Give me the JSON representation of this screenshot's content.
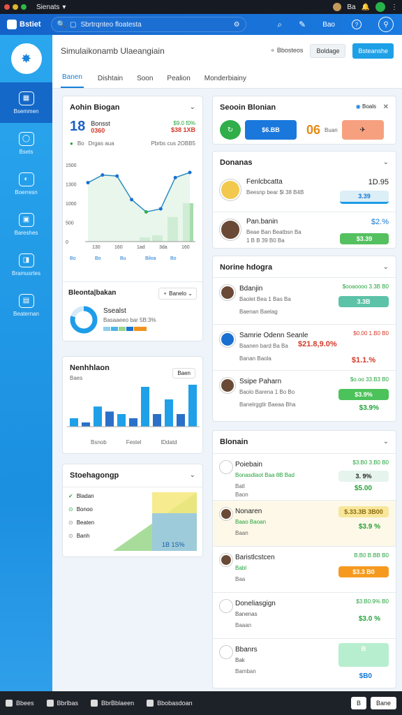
{
  "titlebar": {
    "title": "Sienats",
    "right_text": "Ba"
  },
  "topbar": {
    "logo": "Bstiet",
    "search_placeholder": "Sbrtrqnteo floatesta",
    "btn_label": "Bao"
  },
  "sidebar": {
    "items": [
      {
        "label": "Bsemmen",
        "active": true
      },
      {
        "label": "Bsets"
      },
      {
        "label": "Boerresn"
      },
      {
        "label": "Bareshes"
      },
      {
        "label": "Bramusrtes"
      },
      {
        "label": "Beaternan"
      }
    ]
  },
  "header": {
    "title": "Simulaikonamb Ulaeangiain",
    "link": "Bbosteos",
    "btn_secondary": "Boldage",
    "btn_primary": "Bsteanshe"
  },
  "tabs": [
    "Banen",
    "Dishtain",
    "Soon",
    "Pealion",
    "Monderbiainy"
  ],
  "card_overview": {
    "title": "Aohin Biogan",
    "big_value": "18",
    "sub1": "Bonsst",
    "sub2": "0360",
    "kpi1": "$9.0 f0%",
    "kpi2": "$38 1XB",
    "legend1": "Bo",
    "legend2": "Drgas aua",
    "legend3": "Pbrbs cus 2OBB5",
    "y_ticks": [
      "1500",
      "1300",
      "1000",
      "500",
      "0"
    ],
    "x_ticks": [
      "130",
      "160",
      "1ad",
      "3da",
      "160"
    ],
    "x_labels": [
      "Bo",
      "Bo",
      "Bu",
      "Biloa",
      "Bo"
    ]
  },
  "chart_data": {
    "type": "line",
    "categories": [
      "130",
      "160",
      "1ad",
      "3da",
      "160"
    ],
    "series": [
      {
        "values": [
          1150,
          1300,
          1280,
          820,
          580,
          640,
          1250,
          1350
        ]
      }
    ],
    "bars": [
      80,
      120,
      480,
      750
    ],
    "ylim": [
      0,
      1500
    ]
  },
  "card_donut": {
    "title": "Bleonta|bakan",
    "dropdown": "Banelo",
    "label": "Ssealst",
    "sub": "Basaaeeo bar 5B:3%"
  },
  "card_bars": {
    "title": "Nenhhlaon",
    "btn": "Baen",
    "x_labels": [
      "Bsnob",
      "Festel",
      "lDdatd"
    ],
    "values": [
      20,
      10,
      48,
      36,
      30,
      20,
      95,
      30,
      65,
      30,
      100
    ]
  },
  "card_stack": {
    "title": "Stoehagongp",
    "items": [
      "Bladan",
      "Bonoo",
      "Beaten",
      "Banh"
    ],
    "value": "1B 1S%"
  },
  "card_section": {
    "title": "Seooin Blonian",
    "toggle": "Boals",
    "btn1": "$6.BB",
    "val2": "06",
    "val2_sub": "Buan",
    "btn3": ""
  },
  "card_contacts": {
    "title": "Donanas",
    "rows": [
      {
        "name": "Fenlcbcatta",
        "meta": "Beesnp bear $l 38 B4B",
        "value": "1D.95",
        "pill": "3.39"
      },
      {
        "name": "Pan.banin",
        "meta": "Beae Ban Beatbsn Ba",
        "meta2": "1 B B 39 B0 Ba",
        "value": "$2.%",
        "pill": "$3.39"
      }
    ]
  },
  "card_list1": {
    "title": "Norine hdogra",
    "rows": [
      {
        "name": "Bdanjin",
        "meta": "Baolet Bea 1 Bas Ba",
        "meta2": "Baenan Baelag",
        "amount": "$ooaoooo 3.3B B0",
        "pill": "3.3B",
        "amount_color": "green"
      },
      {
        "name": "Samrie Odenn Seanle",
        "meta": "Baanen bard Ba Ba",
        "meta2": "Banan Baola",
        "amount": "$0.00 1.B0 B0",
        "main": "$21.8,9.0%",
        "pill": "$1.1.%",
        "amount_color": "red"
      },
      {
        "name": "Ssipe Paharn",
        "meta": "Baolo Barena 1 Bo Bo",
        "meta2": "Banelrggtlr Baeaa Bha",
        "amount": "$o.oo 33.B3 B0",
        "pill": "$3.9%",
        "pill2": "$3.9%"
      }
    ]
  },
  "card_list2": {
    "title": "Blonain",
    "rows": [
      {
        "name": "Poiebain",
        "meta": "Bonasdlaot Baa 8B Bad",
        "meta2": "Batl",
        "meta3": "Baon",
        "amount": "$3.B0 3.B0 B0",
        "pill": "3. 9%",
        "val": "$5.00"
      },
      {
        "name": "Nonaren",
        "meta": "Baao Baoan",
        "meta2": "Baan",
        "pill": "$.33.3B 3B00",
        "val": "$3.9 %"
      },
      {
        "name": "Baristlcstcen",
        "meta": "Babl",
        "meta2": "Baa",
        "amount": "B.B0 B.BB B0",
        "pill": "$3.3 B0"
      },
      {
        "name": "Doneliasgign",
        "meta": "Banenas",
        "meta2": "Baaan",
        "amount": "$3.B0.9% B0",
        "val": "$3.0 %"
      },
      {
        "name": "Bbanrs",
        "meta": "Bak",
        "meta2": "Bamban",
        "pill": "B",
        "val": "$B0"
      }
    ]
  },
  "bottombar": {
    "items": [
      "Bbees",
      "Bbrlbas",
      "BbrBblaeen",
      "Bbobasdoan"
    ],
    "btn1": "B",
    "btn2": "Bane"
  }
}
